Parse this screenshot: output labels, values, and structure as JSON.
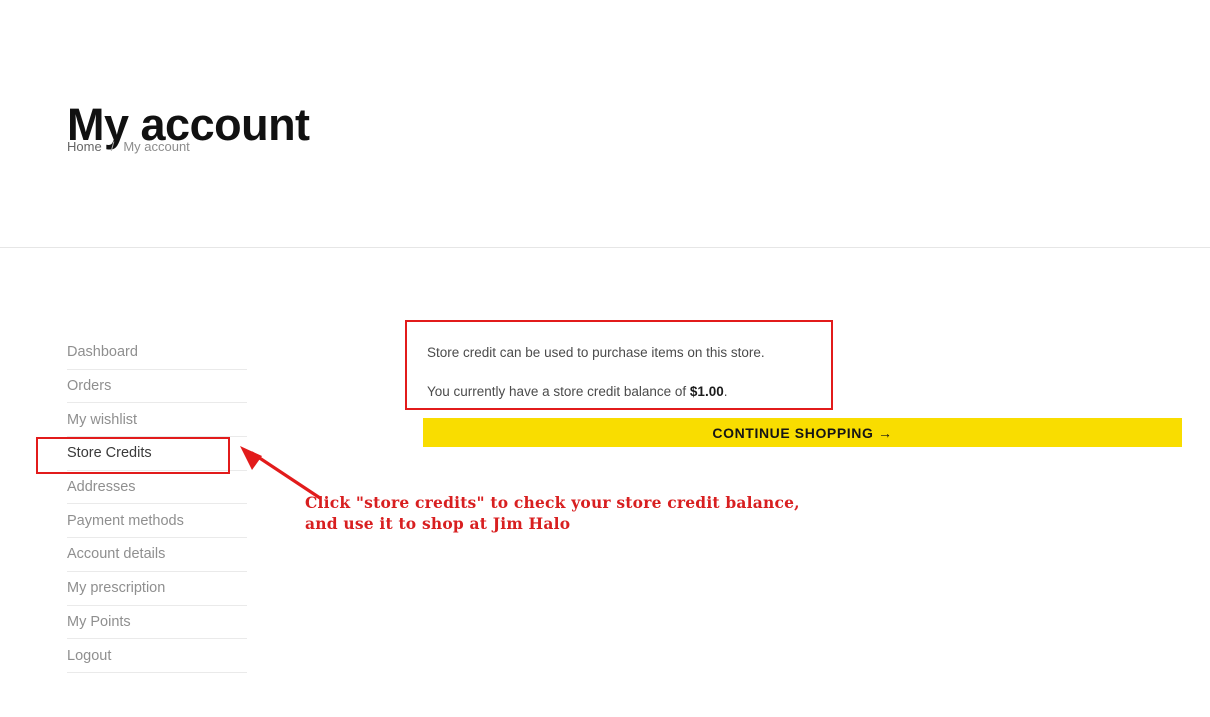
{
  "page": {
    "title": "My account",
    "background": "#ffffff"
  },
  "breadcrumb": {
    "home_label": "Home",
    "separator": "/",
    "current_label": "My account"
  },
  "sidebar": {
    "items": [
      {
        "label": "Dashboard",
        "active": false
      },
      {
        "label": "Orders",
        "active": false
      },
      {
        "label": "My wishlist",
        "active": false
      },
      {
        "label": "Store Credits",
        "active": true
      },
      {
        "label": "Addresses",
        "active": false
      },
      {
        "label": "Payment methods",
        "active": false
      },
      {
        "label": "Account details",
        "active": false
      },
      {
        "label": "My prescription",
        "active": false
      },
      {
        "label": "My Points",
        "active": false
      },
      {
        "label": "Logout",
        "active": false
      }
    ]
  },
  "content": {
    "info_line": "Store credit can be used to purchase items on this store.",
    "balance_prefix": "You currently have a store credit balance of ",
    "balance_amount": "$1.00",
    "balance_suffix": ".",
    "continue_button_label": "CONTINUE SHOPPING →"
  },
  "annotation": {
    "text": "Click \"store credits\" to check your store credit balance,\nand use it to shop at Jim Halo",
    "color": "#d81f20",
    "highlight_target": "Store Credits"
  },
  "colors": {
    "accent_yellow": "#f9dd00",
    "annotation_red": "#e21b1b",
    "text_muted": "#8f8f8f",
    "text_body": "#4b4b4b",
    "divider": "#eaeaea"
  }
}
